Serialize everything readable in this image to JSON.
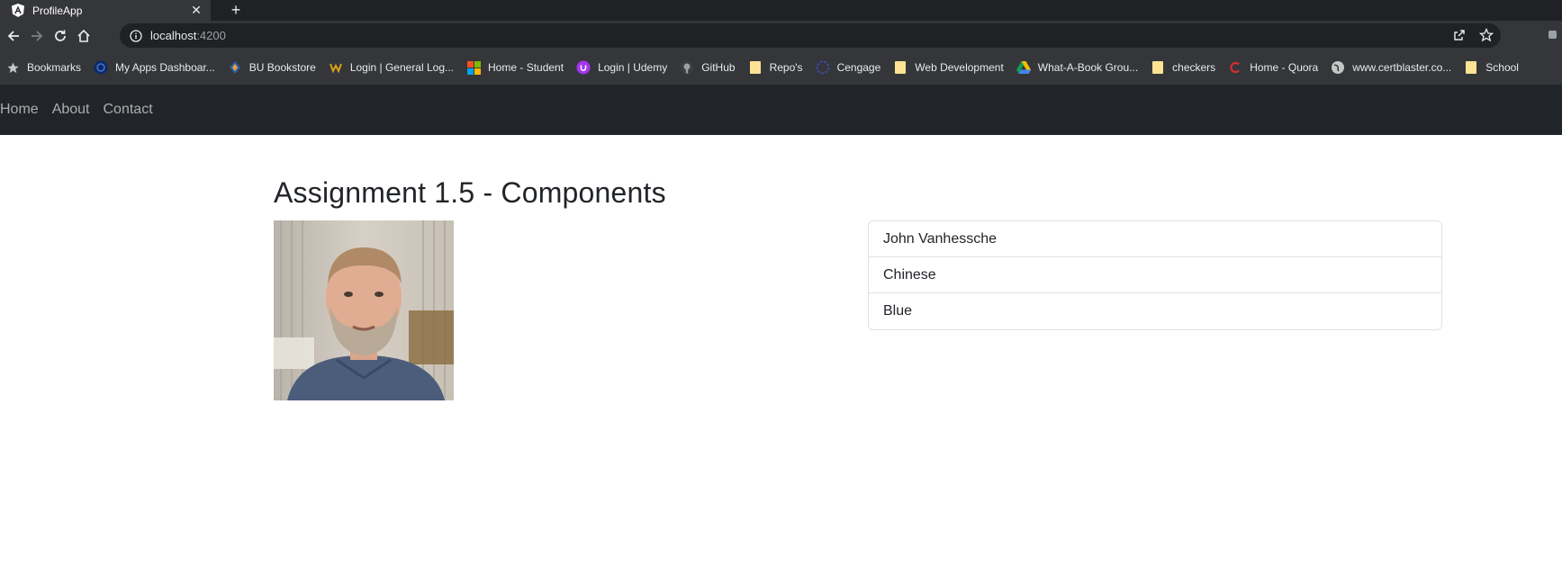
{
  "browser": {
    "tab": {
      "title": "ProfileApp",
      "icon": "angular-icon"
    },
    "address": {
      "host": "localhost",
      "port": ":4200"
    },
    "bookmarks": [
      {
        "label": "Bookmarks",
        "icon": "star-icon"
      },
      {
        "label": "My Apps Dashboar...",
        "icon": "apps-dashboard-icon"
      },
      {
        "label": "BU Bookstore",
        "icon": "bookstore-icon"
      },
      {
        "label": "Login | General Log...",
        "icon": "login-icon"
      },
      {
        "label": "Home - Student",
        "icon": "microsoft-icon"
      },
      {
        "label": "Login | Udemy",
        "icon": "udemy-icon"
      },
      {
        "label": "GitHub",
        "icon": "github-icon"
      },
      {
        "label": "Repo's",
        "icon": "folder-icon"
      },
      {
        "label": "Cengage",
        "icon": "cengage-icon"
      },
      {
        "label": "Web Development",
        "icon": "folder-icon"
      },
      {
        "label": "What-A-Book Grou...",
        "icon": "google-drive-icon"
      },
      {
        "label": "checkers",
        "icon": "folder-icon"
      },
      {
        "label": "Home - Quora",
        "icon": "quora-icon"
      },
      {
        "label": "www.certblaster.co...",
        "icon": "globe-icon"
      },
      {
        "label": "School",
        "icon": "folder-icon"
      }
    ]
  },
  "navbar": {
    "links": [
      "Home",
      "About",
      "Contact"
    ]
  },
  "main": {
    "title": "Assignment 1.5 - Components",
    "photo_icon": "profile-photo",
    "list": [
      "John Vanhessche",
      "Chinese",
      "Blue"
    ]
  },
  "colors": {
    "chrome_dark": "#202124",
    "chrome_toolbar": "#35363a",
    "navbar_bg": "#212529",
    "text": "#212529",
    "border": "#dee2e6"
  }
}
